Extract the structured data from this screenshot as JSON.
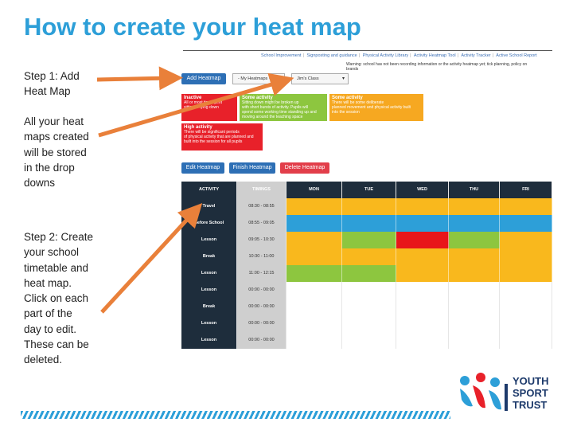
{
  "slide": {
    "title": "How to create your heat map",
    "step1_lines": [
      "Step 1: Add",
      "Heat Map"
    ],
    "note1_lines": [
      "All your heat",
      "maps created",
      "will be stored",
      "in the drop",
      "downs"
    ],
    "step2_lines": [
      "Step 2: Create",
      "your school",
      "timetable and",
      "heat map.",
      "Click on each",
      "part of the",
      "day to edit.",
      "These can be",
      "deleted."
    ]
  },
  "screenshot": {
    "nav": [
      "School Improvement",
      "Signposting and guidance",
      "Physical Activity Library",
      "Activity Heatmap Tool",
      "Activity Tracker",
      "Active School Report"
    ],
    "warning_lines": [
      "Warning: school has not been recording information or the activity heatmap yet; tick planning, policy on",
      "brands"
    ],
    "add_button": "Add Heatmap",
    "heatmap_select": "- My Heatmaps -",
    "class_select": "Jim's Class",
    "legend": [
      {
        "title": "Inactive",
        "lines": [
          "All or most time spent",
          "sitting or lying down"
        ],
        "color": "#e8212a"
      },
      {
        "title": "Some activity",
        "lines": [
          "Sitting down might be broken up",
          "with short bursts of activity. Pupils will",
          "spend some working time standing up and",
          "moving around the teaching space"
        ],
        "color": "#8dc63f"
      },
      {
        "title": "Some activity",
        "lines": [
          "There will be some deliberate",
          "planned movement and physical activity built",
          "into the session"
        ],
        "color": "#f6a821"
      },
      {
        "title": "High activity",
        "lines": [
          "There will be significant periods",
          "of physical activity that are planned and",
          "built into the session for all pupils"
        ],
        "color": "#e8212a"
      }
    ],
    "edit_button": "Edit Heatmap",
    "finish_button": "Finish Heatmap",
    "delete_button": "Delete Heatmap",
    "table": {
      "headers": [
        "ACTIVITY",
        "TIMINGS",
        "MON",
        "TUE",
        "WED",
        "THU",
        "FRI"
      ],
      "rows": [
        {
          "activity": "Travel",
          "time": "08:30 - 08:55",
          "cells": [
            "yellow",
            "yellow",
            "yellow",
            "yellow",
            "yellow"
          ]
        },
        {
          "activity": "Before School",
          "time": "08:55 - 09:05",
          "cells": [
            "blue",
            "blue",
            "blue",
            "blue",
            "blue"
          ]
        },
        {
          "activity": "Lesson",
          "time": "09:05 - 10:30",
          "cells": [
            "yellow",
            "green",
            "red",
            "green",
            "yellow"
          ]
        },
        {
          "activity": "Break",
          "time": "10:30 - 11:00",
          "cells": [
            "yellow",
            "yellow",
            "yellow",
            "yellow",
            "yellow"
          ]
        },
        {
          "activity": "Lesson",
          "time": "11:00 - 12:15",
          "cells": [
            "green",
            "green",
            "yellow",
            "yellow",
            "yellow"
          ]
        },
        {
          "activity": "Lesson",
          "time": "00:00 - 00:00",
          "cells": [
            "white",
            "white",
            "white",
            "white",
            "white"
          ]
        },
        {
          "activity": "Break",
          "time": "00:00 - 00:00",
          "cells": [
            "white",
            "white",
            "white",
            "white",
            "white"
          ]
        },
        {
          "activity": "Lesson",
          "time": "00:00 - 00:00",
          "cells": [
            "white",
            "white",
            "white",
            "white",
            "white"
          ]
        },
        {
          "activity": "Lesson",
          "time": "00:00 - 00:00",
          "cells": [
            "white",
            "white",
            "white",
            "white",
            "white"
          ]
        }
      ]
    },
    "colors": {
      "yellow": "#f9b81d",
      "blue": "#2d9fd8",
      "green": "#8dc63f",
      "red": "#e8161a",
      "white": "#ffffff",
      "accent_blue": "#2d6fb5",
      "arrow_orange": "#e9803a",
      "delete_red": "#e23e4a"
    }
  },
  "logo": {
    "lines": [
      "YOUTH",
      "SPORT",
      "TRUST"
    ]
  }
}
